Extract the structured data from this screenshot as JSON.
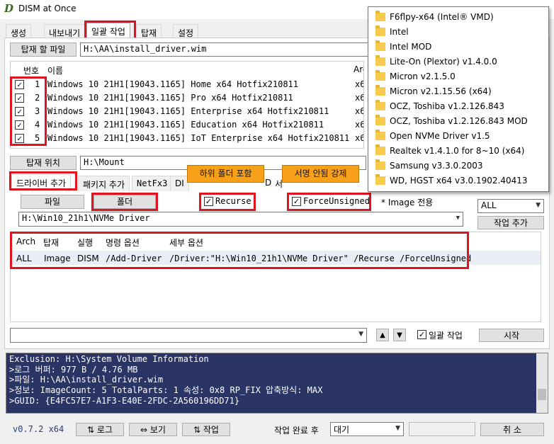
{
  "window": {
    "title": "DISM at Once",
    "icon": "D"
  },
  "tabs": [
    "생성",
    "내보내기",
    "일괄 작업",
    "탑재",
    "설정"
  ],
  "mount_file": {
    "button": "탑재 할 파일",
    "value": "H:\\AA\\install_driver.wim"
  },
  "image_list": {
    "headers": {
      "no": "번호",
      "name": "이름",
      "arch": "Arch"
    },
    "rows": [
      {
        "no": "1",
        "name": "Windows 10 21H1[19043.1165] Home x64 Hotfix210811",
        "arch": "x6"
      },
      {
        "no": "2",
        "name": "Windows 10 21H1[19043.1165] Pro x64 Hotfix210811",
        "arch": "x6"
      },
      {
        "no": "3",
        "name": "Windows 10 21H1[19043.1165] Enterprise x64 Hotfix210811",
        "arch": "x6"
      },
      {
        "no": "4",
        "name": "Windows 10 21H1[19043.1165] Education x64 Hotfix210811",
        "arch": "x6"
      },
      {
        "no": "5",
        "name": "Windows 10 21H1[19043.1165] IoT Enterprise x64 Hotfix210811",
        "arch": "x6"
      }
    ]
  },
  "mount_dir": {
    "button": "탑재 위치",
    "value": "H:\\Mount"
  },
  "subtabs": [
    "드라이버 추가",
    "패키지 추가",
    "NetFx3",
    "DI",
    "D",
    "서"
  ],
  "driver": {
    "file_button": "파일",
    "folder_button": "폴더",
    "recurse_label": "Recurse",
    "force_label": "ForceUnsigned",
    "image_only_note": "* Image 전용",
    "path_value": "H:\\Win10_21h1\\NVMe Driver",
    "arch_select": "ALL",
    "add_task_button": "작업 추가"
  },
  "callouts": {
    "recurse": "하위 폴더 포함",
    "force": "서명 안됨 강제"
  },
  "commands": {
    "headers": [
      "Arch",
      "탑재",
      "실행",
      "명령 옵션",
      "세부 옵션"
    ],
    "rows": [
      {
        "arch": "ALL",
        "mount": "Image",
        "exec": "DISM",
        "option": "/Add-Driver",
        "detail": "/Driver:\"H:\\Win10_21h1\\NVMe Driver\" /Recurse /ForceUnsigned"
      }
    ]
  },
  "batch": {
    "checkbox_label": "일괄 작업",
    "start_button": "시작",
    "up": "▲",
    "down": "▼"
  },
  "log_lines": [
    "Exclusion: H:\\System Volume Information",
    ">로그 버퍼: 977 B / 4.76 MB",
    ">파일: H:\\AA\\install_driver.wim",
    ">정보: ImageCount: 5  TotalParts: 1  속성: 0x8 RP_FIX  압축방식: MAX",
    ">GUID: {E4FC57E7-A1F3-E40E-2FDC-2A560196DD71}"
  ],
  "footer": {
    "version": "v0.7.2 x64",
    "log_button": "⇅ 로그",
    "view_button": "⇔ 보기",
    "task_button": "⇅ 작업",
    "after_label": "작업 완료 후",
    "after_value": "대기",
    "cancel_button": "취 소"
  },
  "folder_menu": [
    "F6flpy-x64 (Intel® VMD)",
    "Intel",
    "Intel MOD",
    "Lite-On (Plextor) v1.4.0.0",
    "Micron v2.1.5.0",
    "Micron v2.1.15.56 (x64)",
    "OCZ, Toshiba v1.2.126.843",
    "OCZ, Toshiba v1.2.126.843 MOD",
    "Open NVMe Driver v1.5",
    "Realtek v1.4.1.0 for 8~10 (x64)",
    "Samsung v3.3.0.2003",
    "WD, HGST x64 v3.0.1902.40413"
  ],
  "colors": {
    "highlight_box": "#e0141e",
    "callout": "#f7a11a",
    "log_bg": "#2a3566",
    "folder": "#f6cb4e"
  }
}
